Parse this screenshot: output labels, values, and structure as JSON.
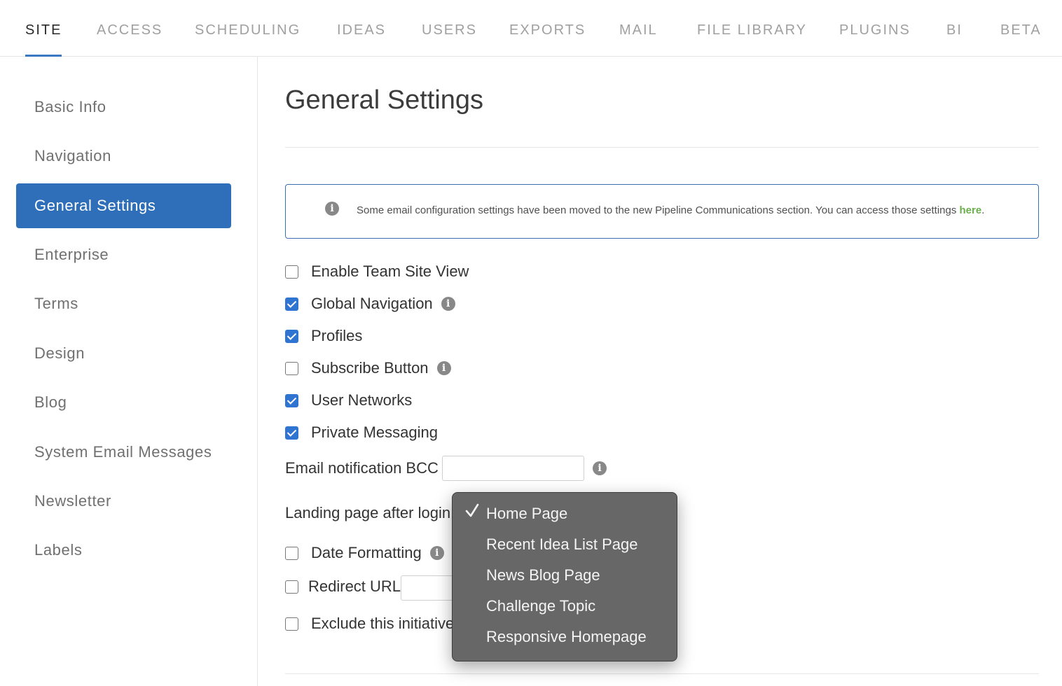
{
  "top_tabs": [
    {
      "label": "SITE",
      "active": true
    },
    {
      "label": "ACCESS"
    },
    {
      "label": "SCHEDULING"
    },
    {
      "label": "IDEAS"
    },
    {
      "label": "USERS"
    },
    {
      "label": "EXPORTS"
    },
    {
      "label": "MAIL"
    },
    {
      "label": "FILE LIBRARY"
    },
    {
      "label": "PLUGINS"
    },
    {
      "label": "BI"
    },
    {
      "label": "BETA"
    }
  ],
  "sidebar": {
    "items": [
      {
        "label": "Basic Info"
      },
      {
        "label": "Navigation"
      },
      {
        "label": "General Settings",
        "active": true
      },
      {
        "label": "Enterprise"
      },
      {
        "label": "Terms"
      },
      {
        "label": "Design"
      },
      {
        "label": "Blog"
      },
      {
        "label": "System Email Messages"
      },
      {
        "label": "Newsletter"
      },
      {
        "label": "Labels"
      }
    ]
  },
  "main": {
    "title": "General Settings",
    "notice": {
      "text": "Some email configuration settings have been moved to the new Pipeline Communications section. You can access those settings ",
      "link": "here",
      "suffix": "."
    },
    "settings": [
      {
        "label": "Enable Team Site View",
        "checked": false,
        "info": false
      },
      {
        "label": "Global Navigation",
        "checked": true,
        "info": true
      },
      {
        "label": "Profiles",
        "checked": true,
        "info": false
      },
      {
        "label": "Subscribe Button",
        "checked": false,
        "info": true
      },
      {
        "label": "User Networks",
        "checked": true,
        "info": false
      },
      {
        "label": "Private Messaging",
        "checked": true,
        "info": false
      }
    ],
    "email_bcc": {
      "label": "Email notification BCC",
      "value": ""
    },
    "landing_page": {
      "label": "Landing page after login:"
    },
    "date_formatting": {
      "label": "Date Formatting",
      "checked": false
    },
    "redirect_url": {
      "label": "Redirect URL",
      "checked": false,
      "value": ""
    },
    "exclude": {
      "label": "Exclude this initiative",
      "checked": false
    }
  },
  "dropdown": {
    "selected": "Home Page",
    "options": [
      "Home Page",
      "Recent Idea List Page",
      "News Blog Page",
      "Challenge Topic",
      "Responsive Homepage"
    ]
  },
  "icons": {
    "info": "info-icon",
    "check": "checkmark-icon"
  },
  "colors": {
    "accent": "#2f6fb9",
    "checkbox": "#2f74d0",
    "link": "#6ab04c",
    "menu_bg": "#626262"
  }
}
